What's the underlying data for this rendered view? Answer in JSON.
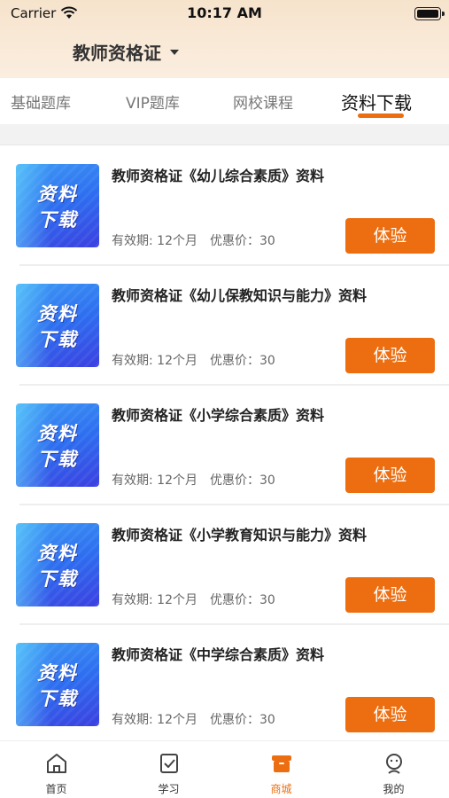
{
  "status_bar": {
    "carrier": "Carrier",
    "time": "10:17 AM"
  },
  "header": {
    "selector_label": "教师资格证"
  },
  "tabs": [
    {
      "label": "基础题库",
      "active": false
    },
    {
      "label": "VIP题库",
      "active": false
    },
    {
      "label": "网校课程",
      "active": false
    },
    {
      "label": "资料下载",
      "active": true
    }
  ],
  "thumbnail": {
    "line1": "资料",
    "line2": "下载"
  },
  "items": [
    {
      "title": "教师资格证《幼儿综合素质》资料",
      "validity": "有效期: 12个月",
      "price": "优惠价：30",
      "button": "体验"
    },
    {
      "title": "教师资格证《幼儿保教知识与能力》资料",
      "validity": "有效期: 12个月",
      "price": "优惠价：30",
      "button": "体验"
    },
    {
      "title": "教师资格证《小学综合素质》资料",
      "validity": "有效期: 12个月",
      "price": "优惠价：30",
      "button": "体验"
    },
    {
      "title": "教师资格证《小学教育知识与能力》资料",
      "validity": "有效期: 12个月",
      "price": "优惠价：30",
      "button": "体验"
    },
    {
      "title": "教师资格证《中学综合素质》资料",
      "validity": "有效期: 12个月",
      "price": "优惠价：30",
      "button": "体验"
    }
  ],
  "tabbar": [
    {
      "label": "首页",
      "icon": "home-icon",
      "active": false
    },
    {
      "label": "学习",
      "icon": "study-icon",
      "active": false
    },
    {
      "label": "商城",
      "icon": "store-icon",
      "active": true
    },
    {
      "label": "我的",
      "icon": "profile-icon",
      "active": false
    }
  ],
  "colors": {
    "accent": "#ec6e10",
    "header_bg": "#f6e3cc",
    "thumb_blue": "#2d6ef0"
  }
}
